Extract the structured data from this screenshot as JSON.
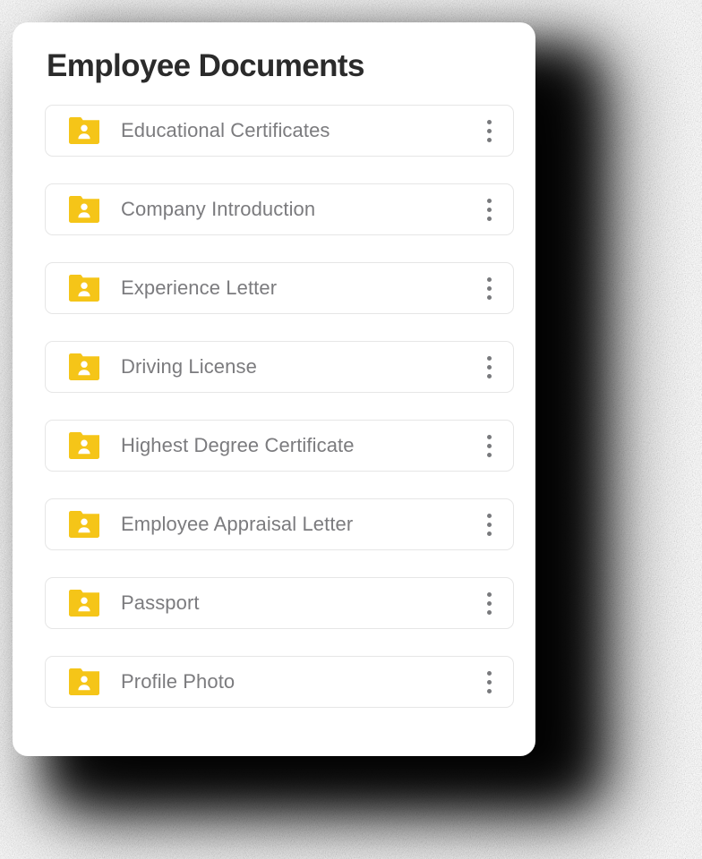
{
  "page": {
    "title": "Employee Documents",
    "background_color": "#ffffff",
    "card_background": "#ffffff",
    "title_color": "#2b2b2b"
  },
  "theme": {
    "folder_icon_color": "#F5C518",
    "folder_glyph_color": "#ffffff",
    "row_border_color": "#e6e6e6",
    "row_label_color": "#7b7b7e",
    "kebab_dot_color": "#78797c",
    "shadow_color": "#111111"
  },
  "documents": [
    {
      "label": "Educational Certificates",
      "icon": "folder-user-icon",
      "menu_icon": "kebab-menu-icon"
    },
    {
      "label": "Company Introduction",
      "icon": "folder-user-icon",
      "menu_icon": "kebab-menu-icon"
    },
    {
      "label": "Experience Letter",
      "icon": "folder-user-icon",
      "menu_icon": "kebab-menu-icon"
    },
    {
      "label": "Driving License",
      "icon": "folder-user-icon",
      "menu_icon": "kebab-menu-icon"
    },
    {
      "label": "Highest Degree Certificate",
      "icon": "folder-user-icon",
      "menu_icon": "kebab-menu-icon"
    },
    {
      "label": "Employee Appraisal Letter",
      "icon": "folder-user-icon",
      "menu_icon": "kebab-menu-icon"
    },
    {
      "label": "Passport",
      "icon": "folder-user-icon",
      "menu_icon": "kebab-menu-icon"
    },
    {
      "label": "Profile Photo",
      "icon": "folder-user-icon",
      "menu_icon": "kebab-menu-icon"
    }
  ]
}
